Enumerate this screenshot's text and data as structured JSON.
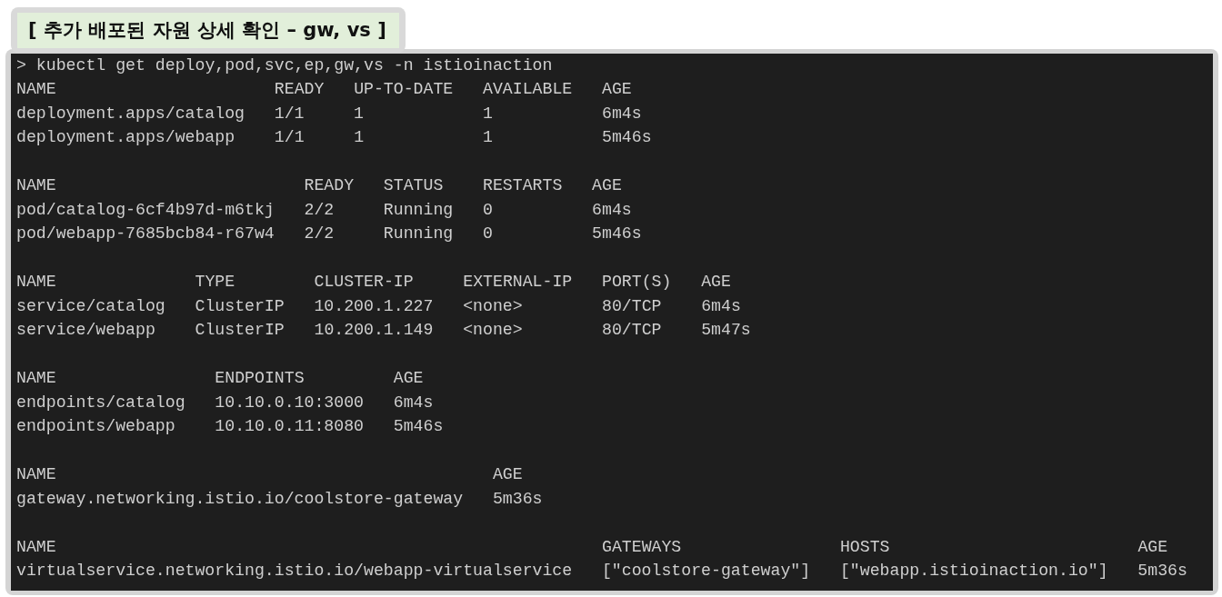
{
  "title": "[ 추가 배포된 자원 상세 확인 – gw, vs ]",
  "terminal": {
    "prompt": ">",
    "command": "kubectl get deploy,pod,svc,ep,gw,vs -n istioinaction",
    "sections": [
      {
        "columns": [
          "NAME",
          "READY",
          "UP-TO-DATE",
          "AVAILABLE",
          "AGE"
        ],
        "rows": [
          [
            "deployment.apps/catalog",
            "1/1",
            "1",
            "1",
            "6m4s"
          ],
          [
            "deployment.apps/webapp",
            "1/1",
            "1",
            "1",
            "5m46s"
          ]
        ]
      },
      {
        "columns": [
          "NAME",
          "READY",
          "STATUS",
          "RESTARTS",
          "AGE"
        ],
        "rows": [
          [
            "pod/catalog-6cf4b97d-m6tkj",
            "2/2",
            "Running",
            "0",
            "6m4s"
          ],
          [
            "pod/webapp-7685bcb84-r67w4",
            "2/2",
            "Running",
            "0",
            "5m46s"
          ]
        ]
      },
      {
        "columns": [
          "NAME",
          "TYPE",
          "CLUSTER-IP",
          "EXTERNAL-IP",
          "PORT(S)",
          "AGE"
        ],
        "rows": [
          [
            "service/catalog",
            "ClusterIP",
            "10.200.1.227",
            "<none>",
            "80/TCP",
            "6m4s"
          ],
          [
            "service/webapp",
            "ClusterIP",
            "10.200.1.149",
            "<none>",
            "80/TCP",
            "5m47s"
          ]
        ]
      },
      {
        "columns": [
          "NAME",
          "ENDPOINTS",
          "AGE"
        ],
        "rows": [
          [
            "endpoints/catalog",
            "10.10.0.10:3000",
            "6m4s"
          ],
          [
            "endpoints/webapp",
            "10.10.0.11:8080",
            "5m46s"
          ]
        ]
      },
      {
        "columns": [
          "NAME",
          "AGE"
        ],
        "rows": [
          [
            "gateway.networking.istio.io/coolstore-gateway",
            "5m36s"
          ]
        ]
      },
      {
        "columns": [
          "NAME",
          "GATEWAYS",
          "HOSTS",
          "AGE"
        ],
        "rows": [
          [
            "virtualservice.networking.istio.io/webapp-virtualservice",
            "[\"coolstore-gateway\"]",
            "[\"webapp.istioinaction.io\"]",
            "5m36s"
          ]
        ]
      }
    ]
  }
}
